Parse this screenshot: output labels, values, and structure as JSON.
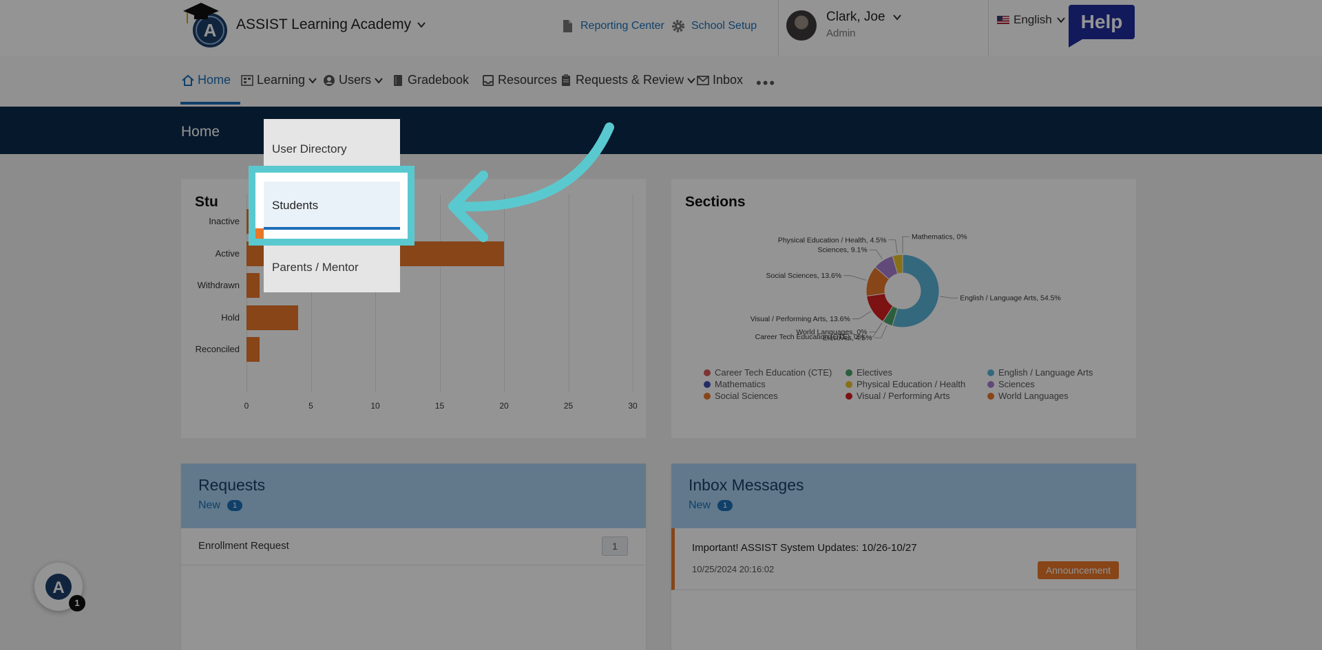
{
  "header": {
    "school_name": "ASSIST Learning Academy",
    "reporting_center": "Reporting Center",
    "school_setup": "School Setup",
    "user_name": "Clark, Joe",
    "user_role": "Admin",
    "language": "English",
    "help": "Help"
  },
  "nav": {
    "items": [
      "Home",
      "Learning",
      "Users",
      "Gradebook",
      "Resources",
      "Requests & Review",
      "Inbox"
    ],
    "more": "•••"
  },
  "banner": {
    "title": "Home"
  },
  "students_card": {
    "title": "Stu",
    "chart_data": {
      "type": "bar",
      "orientation": "horizontal",
      "categories": [
        "Inactive",
        "Active",
        "Withdrawn",
        "Hold",
        "Reconciled"
      ],
      "values": [
        1,
        20,
        1,
        4,
        1
      ],
      "xlim": [
        0,
        30
      ],
      "xticks": [
        0,
        5,
        10,
        15,
        20,
        25,
        30
      ],
      "color": "#e8772a",
      "grid": true
    }
  },
  "sections_card": {
    "title": "Sections",
    "chart_data": {
      "type": "pie",
      "donut": true,
      "slices": [
        {
          "name": "English / Language Arts",
          "label": "English / Language Arts, 54.5%",
          "value": 54.5,
          "color": "#5bb4d8"
        },
        {
          "name": "Electives",
          "label": "Electives, 4.5%",
          "value": 4.5,
          "color": "#4aa36a"
        },
        {
          "name": "Career Tech Education (CTE)",
          "label": "Career Tech Education (CTE), 0%",
          "value": 0,
          "color": "#d85a5a"
        },
        {
          "name": "World Languages",
          "label": "World Languages, 0%",
          "value": 0,
          "color": "#e8772a"
        },
        {
          "name": "Visual / Performing Arts",
          "label": "Visual / Performing Arts, 13.6%",
          "value": 13.6,
          "color": "#d62020"
        },
        {
          "name": "Social Sciences",
          "label": "Social Sciences, 13.6%",
          "value": 13.6,
          "color": "#e8772a"
        },
        {
          "name": "Sciences",
          "label": "Sciences, 9.1%",
          "value": 9.1,
          "color": "#a77fd0"
        },
        {
          "name": "Physical Education / Health",
          "label": "Physical Education / Health, 4.5%",
          "value": 4.5,
          "color": "#e8c12a"
        },
        {
          "name": "Mathematics",
          "label": "Mathematics, 0%",
          "value": 0,
          "color": "#3d4fb0"
        }
      ],
      "legend": [
        {
          "name": "Career Tech Education (CTE)",
          "color": "#d85a5a"
        },
        {
          "name": "Electives",
          "color": "#4aa36a"
        },
        {
          "name": "English / Language Arts",
          "color": "#5bb4d8"
        },
        {
          "name": "Mathematics",
          "color": "#3d4fb0"
        },
        {
          "name": "Physical Education / Health",
          "color": "#e8c12a"
        },
        {
          "name": "Sciences",
          "color": "#a77fd0"
        },
        {
          "name": "Social Sciences",
          "color": "#e8772a"
        },
        {
          "name": "Visual / Performing Arts",
          "color": "#d62020"
        },
        {
          "name": "World Languages",
          "color": "#e8772a"
        }
      ],
      "legend_position": "bottom"
    }
  },
  "requests": {
    "title": "Requests",
    "new_label": "New",
    "new_count": "1",
    "rows": [
      {
        "label": "Enrollment Request",
        "count": "1"
      }
    ]
  },
  "inbox": {
    "title": "Inbox Messages",
    "new_label": "New",
    "new_count": "1",
    "messages": [
      {
        "subject": "Important! ASSIST System Updates: 10/26-10/27",
        "date": "10/25/2024 20:16:02",
        "badge": "Announcement"
      }
    ]
  },
  "fab": {
    "count": "1"
  },
  "users_dropdown": {
    "items": [
      "User Directory",
      "Students",
      "Parents / Mentor"
    ],
    "highlighted": "Students"
  }
}
